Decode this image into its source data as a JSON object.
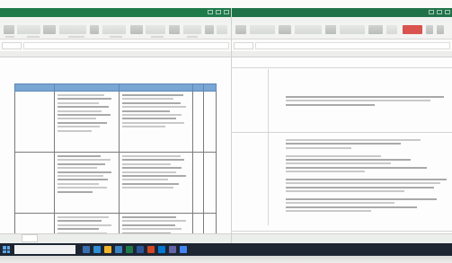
{
  "left_window": {
    "title": "",
    "table": {
      "headers": [
        "",
        "",
        "",
        "",
        ""
      ],
      "rows": [
        {
          "label": ""
        },
        {
          "label": ""
        },
        {
          "label": ""
        }
      ]
    },
    "sheet_tab": ""
  },
  "right_window": {
    "title": "",
    "row_labels": [
      "",
      ""
    ]
  },
  "taskbar": {
    "search_placeholder": "",
    "tray_text": ""
  },
  "colors": {
    "excel_green": "#1f7a4a",
    "table_header_blue": "#7aa6d4",
    "taskbar": "#1d2533",
    "accent_red": "#d9534f"
  }
}
